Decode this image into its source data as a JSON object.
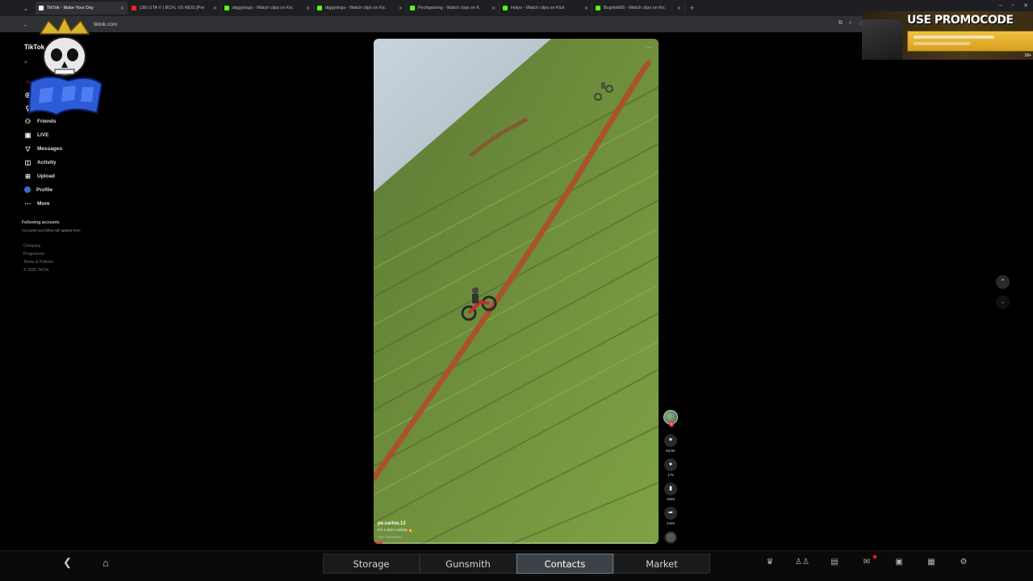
{
  "browser": {
    "tabs": [
      {
        "title": "TikTok - Make Your Day",
        "color": "#ffffff",
        "active": true
      },
      {
        "title": "(38) GTA V | BCFL VS WDS [Pre",
        "color": "#ff2020",
        "active": false
      },
      {
        "title": "diggydogs - Watch clips on Kic",
        "color": "#53fc18",
        "active": false
      },
      {
        "title": "diggydogs - Watch clips on Kic",
        "color": "#53fc18",
        "active": false
      },
      {
        "title": "Pechgaming - Watch clips on K",
        "color": "#53fc18",
        "active": false
      },
      {
        "title": "Hulyo - Watch clips on Kick",
        "color": "#53fc18",
        "active": false
      },
      {
        "title": "Bugrits666 - Watch clips on Kic",
        "color": "#53fc18",
        "active": false
      }
    ],
    "url": "tiktok.com"
  },
  "sidebar": {
    "logo": "TikTok",
    "items": [
      {
        "label": "Friends",
        "icon": "friends-icon"
      },
      {
        "label": "LIVE",
        "icon": "live-icon"
      },
      {
        "label": "Messages",
        "icon": "messages-icon"
      },
      {
        "label": "Activity",
        "icon": "activity-icon"
      },
      {
        "label": "Upload",
        "icon": "upload-icon"
      },
      {
        "label": "Profile",
        "icon": "profile-icon"
      },
      {
        "label": "More",
        "icon": "more-icon"
      }
    ],
    "following_title": "Following accounts",
    "following_sub": "Accounts you follow will appear here",
    "footer": [
      "Company",
      "Programme",
      "Terms & Policies",
      "© 2025 TikTok"
    ]
  },
  "video": {
    "username": "pe.carlos.13",
    "description": "Fiz a bem subida 🔥",
    "translation": "See translation",
    "progress": 0.03
  },
  "actions": {
    "likes": "66.8K",
    "comments": "175",
    "saves": "2559",
    "shares": "4346"
  },
  "promo": {
    "title": "USE PROMOCODE",
    "age": "18+"
  },
  "hud": {
    "tabs": [
      "Storage",
      "Gunsmith",
      "Contacts",
      "Market"
    ],
    "active_tab": "Contacts"
  }
}
